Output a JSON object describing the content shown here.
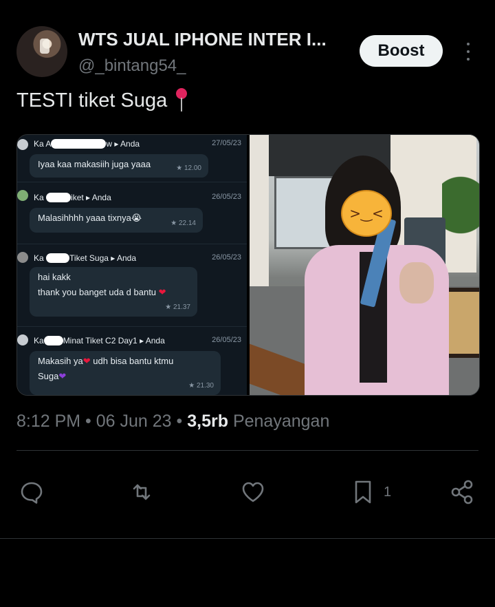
{
  "tweet": {
    "display_name": "WTS JUAL IPHONE INTER I...",
    "handle": "@_bintang54_",
    "boost_label": "Boost",
    "text": "TESTI tiket Suga",
    "timestamp": "8:12 PM • 06 Jun 23 •",
    "views_count": "3,5rb",
    "views_label": "Penayangan"
  },
  "actions": {
    "reply_icon": "speech-bubble-icon",
    "retweet_icon": "repost-arrows-icon",
    "like_icon": "heart-icon",
    "bookmark_icon": "bookmark-icon",
    "bookmark_count": "1",
    "share_icon": "share-nodes-icon"
  },
  "chat": [
    {
      "name_prefix": "Ka A",
      "name_suffix": "w ▸ Anda",
      "date": "27/05/23",
      "lines": [
        "Iyaa kaa makasiih juga yaaa"
      ],
      "time": "★ 12.00"
    },
    {
      "name_prefix": "Ka",
      "name_suffix": "iket ▸ Anda",
      "date": "26/05/23",
      "lines": [
        "Malasihhhh yaaa tixnya😭"
      ],
      "time": "★ 22.14"
    },
    {
      "name_prefix": "Ka",
      "name_suffix": "Tiket Suga ▸ Anda",
      "date": "26/05/23",
      "lines": [
        "hai kakk",
        "thank you banget uda d bantu"
      ],
      "time": "★ 21.37"
    },
    {
      "name_prefix": "Ka",
      "name_suffix": "Minat Tiket C2 Day1 ▸ Anda",
      "date": "26/05/23",
      "lines": [
        "Makasih ya",
        "udh bisa bantu ktmu",
        "Suga"
      ],
      "time": "★ 21.30"
    }
  ],
  "colors": {
    "background": "#000000",
    "text": "#e7e9ea",
    "muted": "#71767b",
    "boost_bg": "#eff3f4",
    "border": "#2f3336"
  }
}
